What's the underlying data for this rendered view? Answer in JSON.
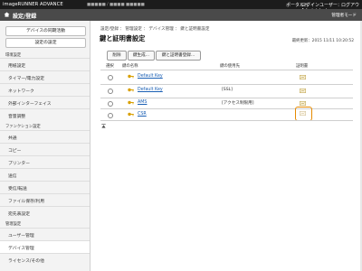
{
  "header": {
    "brand": "imageRUNNER ADVANCE",
    "device_info": "■■■■■ / ■■■■ ■■■■■",
    "portal": "ポータルへ",
    "login_user": "ログインユーザー： Administrator",
    "logout": "ログアウト"
  },
  "section_bar": {
    "title": "設定/登録",
    "manager_mode": "管理者モード"
  },
  "sidebar": {
    "sync_button": "デバイスの同期活動",
    "export_button": "設定の設定",
    "groups": {
      "prefs": "環境設定",
      "function": "ファンクション設定",
      "admin": "管理設定"
    },
    "items": [
      "用紙設定",
      "タイマー/電力設定",
      "ネットワーク",
      "外部インターフェイス",
      "音量調整",
      "共通",
      "コピー",
      "プリンター",
      "送信",
      "受信/転送",
      "ファイル保存/利用",
      "宛先表設定",
      "ユーザー管理",
      "デバイス管理",
      "ライセンス/その他"
    ]
  },
  "main": {
    "breadcrumb": "設定/登録 ： 管理設定 ： デバイス管理 ： 鍵と証明書設定",
    "title": "鍵と証明書設定",
    "last_updated": "最終更新：2015 11/11 10:20:52",
    "buttons": {
      "delete": "削除",
      "generate": "鍵生成...",
      "register_cert": "鍵と証明書登録..."
    },
    "columns": {
      "select": "選択",
      "key_name": "鍵の名称",
      "key_usage": "鍵の使用先",
      "certificate": "証明書"
    },
    "rows": [
      {
        "name": "Default Key",
        "usage": ""
      },
      {
        "name": "Default Key",
        "usage": "[SSL]"
      },
      {
        "name": "AMS",
        "usage": "[アクセス制限用]"
      },
      {
        "name": "CSR",
        "usage": ""
      }
    ]
  },
  "colors": {
    "accent_link": "#1a5fb4",
    "highlight": "#e68a00",
    "topbar": "#1c1c1c",
    "section_bar": "#4a4a4a"
  }
}
